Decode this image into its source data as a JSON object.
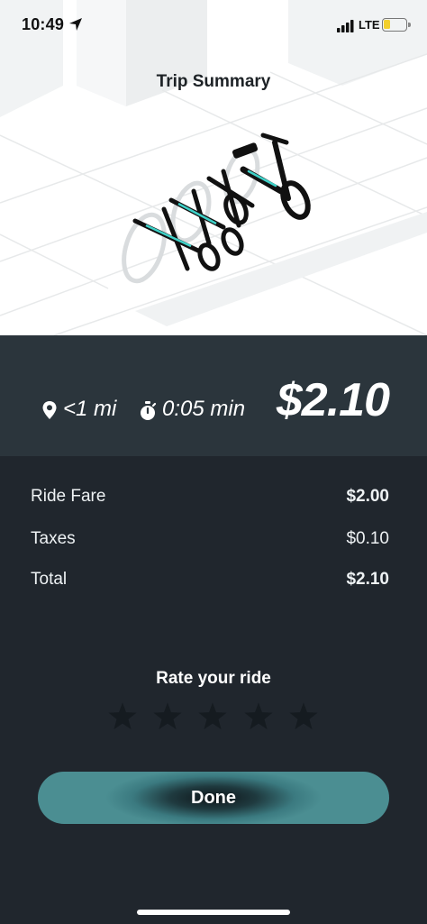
{
  "status_bar": {
    "time": "10:49",
    "network": "LTE",
    "battery_level": 0.3,
    "battery_color": "#f2cf2d"
  },
  "header": {
    "title": "Trip Summary"
  },
  "illustration": {
    "subject": "scooters-parked-at-rack"
  },
  "summary": {
    "distance": "<1 mi",
    "duration": "0:05 min",
    "total_price": "$2.10"
  },
  "fare": {
    "rows": [
      {
        "label": "Ride Fare",
        "value": "$2.00",
        "bold": true
      },
      {
        "label": "Taxes",
        "value": "$0.10",
        "bold": false
      },
      {
        "label": "Total",
        "value": "$2.10",
        "bold": true
      }
    ]
  },
  "rating": {
    "title": "Rate your ride",
    "max_stars": 5,
    "selected": 0,
    "star_color": "#151b20"
  },
  "actions": {
    "done_label": "Done"
  },
  "colors": {
    "accent": "#4b8e92",
    "panel": "#2b353c",
    "background": "#20262d"
  }
}
